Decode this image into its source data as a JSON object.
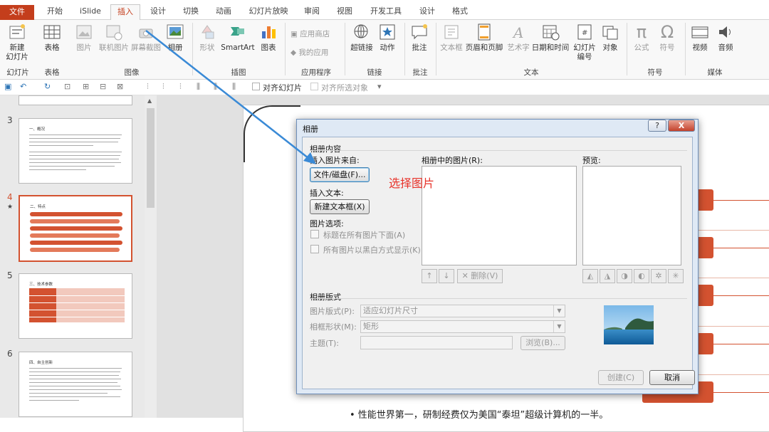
{
  "tabs": {
    "items": [
      {
        "label": "文件"
      },
      {
        "label": "开始"
      },
      {
        "label": "iSlide"
      },
      {
        "label": "插入"
      },
      {
        "label": "设计"
      },
      {
        "label": "切换"
      },
      {
        "label": "动画"
      },
      {
        "label": "幻灯片放映"
      },
      {
        "label": "审阅"
      },
      {
        "label": "视图"
      },
      {
        "label": "开发工具"
      },
      {
        "label": "设计"
      },
      {
        "label": "格式"
      }
    ]
  },
  "ribbon": {
    "new_slide": "新建\n幻灯片",
    "table": "表格",
    "picture": "图片",
    "online_picture": "联机图片",
    "screenshot": "屏幕截图",
    "album": "相册",
    "shapes": "形状",
    "smartart": "SmartArt",
    "chart": "图表",
    "app_store": "应用商店",
    "my_apps": "我的应用",
    "hyperlink": "超链接",
    "action": "动作",
    "comment": "批注",
    "textbox": "文本框",
    "header_footer": "页眉和页脚",
    "wordart": "艺术字",
    "datetime": "日期和时间",
    "slide_number": "幻灯片\n编号",
    "object": "对象",
    "equation": "公式",
    "symbol": "符号",
    "video": "视频",
    "audio": "音频",
    "groups": {
      "slides": "幻灯片",
      "tables": "表格",
      "images": "图像",
      "illustrations": "插图",
      "apps": "应用程序",
      "links": "链接",
      "comments": "批注",
      "text": "文本",
      "symbols": "符号",
      "media": "媒体"
    }
  },
  "qat": {
    "align_slide": "对齐幻灯片",
    "align_selected": "对齐所选对象"
  },
  "thumbnails": [
    {
      "num": "3",
      "title": "一、概况"
    },
    {
      "num": "4",
      "title": "二、特点"
    },
    {
      "num": "5",
      "title": "三、技术参数"
    },
    {
      "num": "6",
      "title": "四、自主创新"
    }
  ],
  "dialog": {
    "title": "相册",
    "help": "?",
    "close": "X",
    "section_content": "相册内容",
    "insert_from": "插入图片来自:",
    "file_disk": "文件/磁盘(F)...",
    "insert_text": "插入文本:",
    "new_textbox": "新建文本框(X)",
    "picture_options": "图片选项:",
    "caption_below": "标题在所有图片下面(A)",
    "all_bw": "所有图片以黑白方式显示(K)",
    "pictures_in_album": "相册中的图片(R):",
    "preview": "预览:",
    "delete": "删除(V)",
    "section_layout": "相册版式",
    "picture_layout_label": "图片版式(P):",
    "picture_layout_value": "适应幻灯片尺寸",
    "frame_shape_label": "相框形状(M):",
    "frame_shape_value": "矩形",
    "theme_label": "主题(T):",
    "browse": "浏览(B)...",
    "create": "创建(C)",
    "cancel": "取消"
  },
  "annotation": "选择图片",
  "slide_text": "• 性能世界第一，研制经费仅为美国“泰坦”超级计算机的一半。",
  "colors": {
    "accent": "#c43e1c",
    "slide_accent": "#d35230",
    "annotation": "#e8332a",
    "arrow": "#3a8ad6"
  }
}
